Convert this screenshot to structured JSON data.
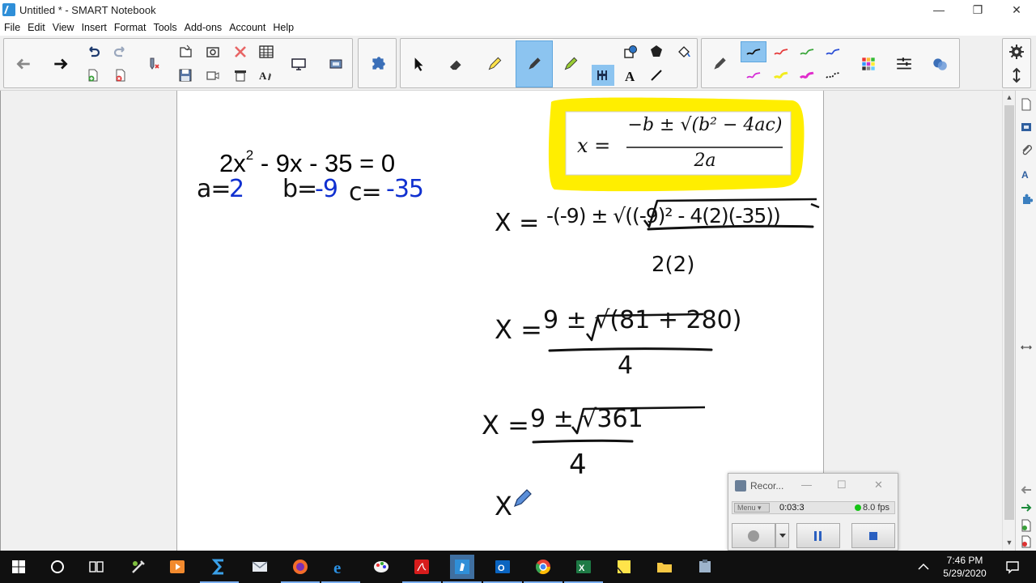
{
  "window": {
    "title": "Untitled * - SMART Notebook",
    "minimize": "—",
    "restore": "❐",
    "close": "✕"
  },
  "menu": [
    "File",
    "Edit",
    "View",
    "Insert",
    "Format",
    "Tools",
    "Add-ons",
    "Account",
    "Help"
  ],
  "toolbar": {
    "icons": [
      "back-arrow-icon",
      "forward-arrow-icon",
      "undo-icon",
      "redo-icon",
      "add-page-icon",
      "delete-page-icon",
      "clear-ink-icon",
      "open-file-icon",
      "save-icon",
      "screen-capture-icon",
      "video-icon",
      "delete-icon",
      "screen-shade-icon",
      "table-icon",
      "handwriting-to-text-icon",
      "display-icon",
      "add-ons-icon",
      "select-icon",
      "eraser-icon",
      "highlighter-icon",
      "pen-icon",
      "magic-pen-icon",
      "shapes-icon",
      "polygon-icon",
      "fill-icon",
      "measure-icon",
      "text-icon",
      "line-icon",
      "properties-pen-icon",
      "color-palette-icon",
      "line-style-icon",
      "more-icon",
      "settings-icon",
      "move-toolbar-icon"
    ],
    "accent": "#8cc4f0"
  },
  "canvas": {
    "equation": {
      "lead": "2x",
      "exp": "2",
      "rest": " - 9x - 35 = 0"
    },
    "coefficients": {
      "a_label": "a=",
      "a_value": "2",
      "b_label": "b=",
      "b_value": "-9",
      "c_label": "c=",
      "c_value": "-35"
    },
    "formula": {
      "lhs": "x =",
      "numerator": "−b ± √(b² − 4ac)",
      "denominator": "2a",
      "highlight": "#ffee00"
    },
    "steps": [
      {
        "lhs": "X =",
        "numerator": "-(-9) ± √((-9)² - 4(2)(-35))",
        "denominator": "2(2)"
      },
      {
        "lhs": "X =",
        "numerator": "9 ± √(81 + 280)",
        "denominator": "4"
      },
      {
        "lhs": "X =",
        "numerator": "9 ± √361",
        "denominator": "4"
      },
      {
        "lhs": "X"
      }
    ],
    "ink_color": "#1a1a1a",
    "blue_ink": "#1030d0"
  },
  "recorder": {
    "title": "Recor...",
    "menu_label": "Menu ▾",
    "time": "0:03:3",
    "fps": "8.0 fps"
  },
  "taskbar": {
    "time": "7:46 PM",
    "date": "5/29/2020",
    "apps": [
      "windows-start-icon",
      "cortana-icon",
      "task-view-icon",
      "tool-icon",
      "video-player-icon",
      "sigma-icon",
      "mail-icon",
      "firefox-icon",
      "edge-icon",
      "paint-icon",
      "acrobat-icon",
      "smart-notebook-icon",
      "outlook-icon",
      "chrome-icon",
      "excel-icon",
      "sticky-notes-icon",
      "file-explorer-icon",
      "app-icon"
    ]
  }
}
